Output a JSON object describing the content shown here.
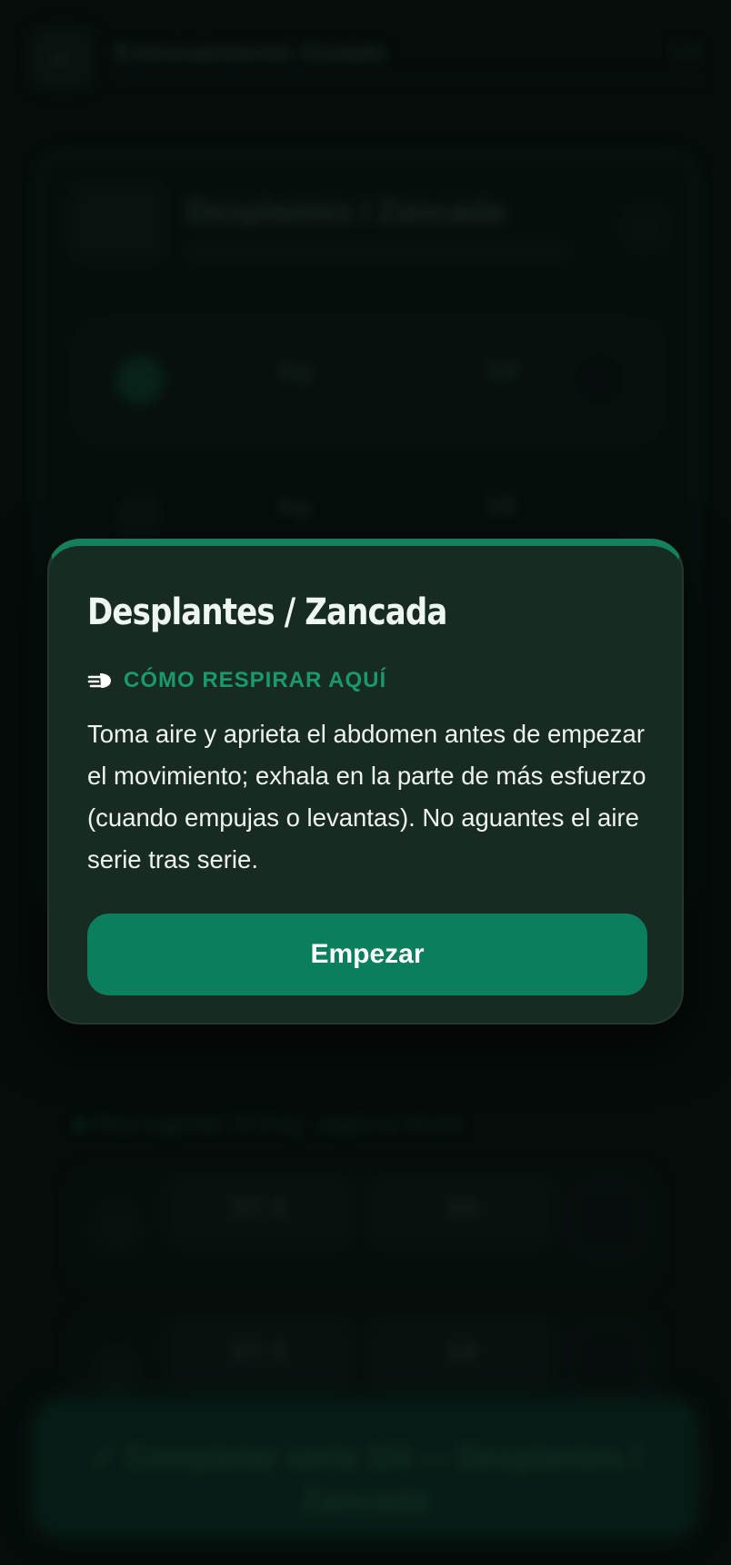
{
  "background": {
    "header": {
      "title": "Entrenamiento Guiado",
      "meta": "1/6"
    },
    "exercise": {
      "title": "Desplantes / Zancada"
    },
    "sets": [
      {
        "weight": "kg",
        "reps": "10"
      },
      {
        "weight": "kg",
        "reps": "10"
      }
    ],
    "hint": "Peso sugerido: 37.5 kg · según tu récord",
    "next_sets": [
      {
        "weight": "37.5",
        "reps": "10"
      },
      {
        "weight": "37.5",
        "reps": "10"
      }
    ],
    "complete_button": "✓ Completar serie 1/4 — Desplantes / Zancada"
  },
  "modal": {
    "title": "Desplantes / Zancada",
    "section_label": "CÓMO RESPIRAR AQUÍ",
    "section_icon": "wind-icon",
    "body": "Toma aire y aprieta el abdomen antes de empezar el movimiento; exhala en la parte de más esfuerzo (cuando empujas o levantas). No aguantes el aire serie tras serie.",
    "start_button": "Empezar",
    "accent_color": "#0b7e5d",
    "label_color": "#1a9a6c"
  }
}
